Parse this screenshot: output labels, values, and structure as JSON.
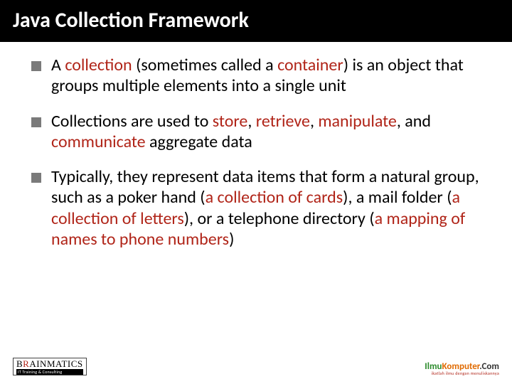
{
  "title": "Java Collection Framework",
  "bullets": [
    {
      "pre": "A ",
      "kw1": "collection",
      "mid1": "  (sometimes called a ",
      "kw2": "container",
      "post": ") is an object that groups multiple elements into a single unit"
    },
    {
      "pre": "Collections are used to ",
      "kw1": "store",
      "mid1": ", ",
      "kw2": "retrieve",
      "mid2": ", ",
      "kw3": "manipulate",
      "mid3": ", and ",
      "kw4": "communicate",
      "post": " aggregate data"
    },
    {
      "pre": "Typically, they represent data items that form a natural group, such as a poker hand (",
      "kw1": "a collection of cards",
      "mid1": "), a mail folder (",
      "kw2": "a collection of letters",
      "mid2": "), or a telephone directory (",
      "kw3": "a mapping of names to phone numbers",
      "post": ")"
    }
  ],
  "footer": {
    "left_top_1": "B",
    "left_top_accent": "R",
    "left_top_2": "AINMATICS",
    "left_sub": "IT Training & Consulting",
    "right_1": "Ilmu",
    "right_2": "Komputer",
    "right_3": ".Com",
    "right_sub": "ikatlah ilmu dengan menuliskannya"
  }
}
